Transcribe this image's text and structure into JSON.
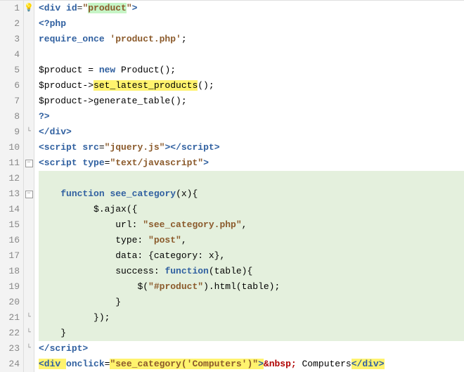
{
  "lines": [
    {
      "n": "1",
      "fold": "box-",
      "bulb": true
    },
    {
      "n": "2",
      "fold": ""
    },
    {
      "n": "3",
      "fold": ""
    },
    {
      "n": "4",
      "fold": ""
    },
    {
      "n": "5",
      "fold": ""
    },
    {
      "n": "6",
      "fold": ""
    },
    {
      "n": "7",
      "fold": ""
    },
    {
      "n": "8",
      "fold": ""
    },
    {
      "n": "9",
      "fold": "end"
    },
    {
      "n": "10",
      "fold": ""
    },
    {
      "n": "11",
      "fold": "box-"
    },
    {
      "n": "12",
      "fold": "",
      "bg": true
    },
    {
      "n": "13",
      "fold": "box-",
      "bg": true
    },
    {
      "n": "14",
      "fold": "",
      "bg": true
    },
    {
      "n": "15",
      "fold": "",
      "bg": true
    },
    {
      "n": "16",
      "fold": "",
      "bg": true
    },
    {
      "n": "17",
      "fold": "",
      "bg": true
    },
    {
      "n": "18",
      "fold": "",
      "bg": true
    },
    {
      "n": "19",
      "fold": "",
      "bg": true
    },
    {
      "n": "20",
      "fold": "",
      "bg": true
    },
    {
      "n": "21",
      "fold": "end",
      "bg": true
    },
    {
      "n": "22",
      "fold": "end",
      "bg": true
    },
    {
      "n": "23",
      "fold": "end"
    },
    {
      "n": "24",
      "fold": ""
    }
  ],
  "code": {
    "l1": {
      "a": "<div ",
      "b": "id",
      "c": "=",
      "d": "\"",
      "e": "product",
      "f": "\"",
      "g": ">"
    },
    "l2": "<?php",
    "l3": {
      "a": "require_once ",
      "b": "'product.php'",
      "c": ";"
    },
    "l5": {
      "a": "$product = ",
      "b": "new ",
      "c": "Product();"
    },
    "l6": {
      "a": "$product->",
      "b": "set_latest_products",
      "c": "();"
    },
    "l7": "$product->generate_table();",
    "l8": "?>",
    "l9": "</div>",
    "l10": {
      "a": "<script ",
      "b": "src",
      "c": "=",
      "d": "\"jquery.js\"",
      "e": "></",
      "f": "script",
      "g": ">"
    },
    "l11": {
      "a": "<script ",
      "b": "type",
      "c": "=",
      "d": "\"text/javascript\"",
      "e": ">"
    },
    "l13": {
      "a": "function ",
      "b": "see_category",
      "c": "(x){"
    },
    "l14": "$.ajax({",
    "l15": {
      "a": "url: ",
      "b": "\"see_category.php\"",
      "c": ","
    },
    "l16": {
      "a": "type: ",
      "b": "\"post\"",
      "c": ","
    },
    "l17": "data: {category: x},",
    "l18": {
      "a": "success: ",
      "b": "function",
      "c": "(table){"
    },
    "l19": {
      "a": "$(",
      "b": "\"#product\"",
      "c": ").html(table);"
    },
    "l20": "}",
    "l21": "});",
    "l22": "}",
    "l23": {
      "a": "</",
      "b": "script",
      "c": ">"
    },
    "l24": {
      "a": "<div ",
      "b": "onclick",
      "c": "=",
      "d": "\"see_category('Computers')\"",
      "e": ">",
      "f": "&nbsp;",
      "g": " Computers",
      "h": "</div>"
    }
  }
}
